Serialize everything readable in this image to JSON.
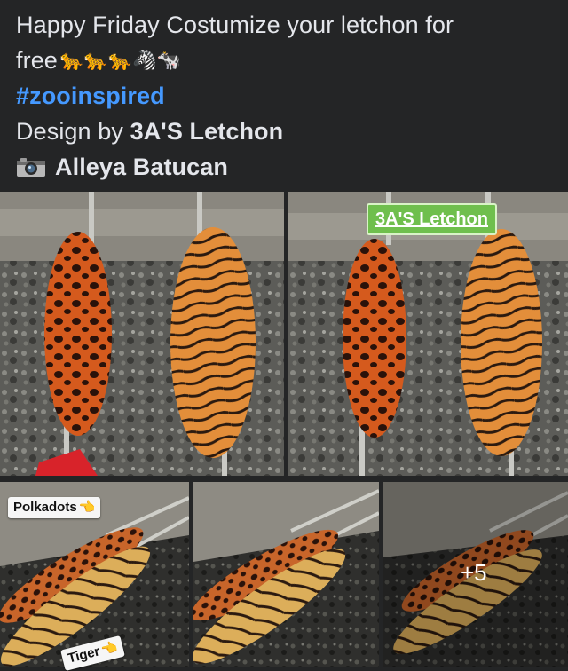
{
  "post": {
    "line1": "Happy Friday Costumize your letchon for",
    "line2_text": "free",
    "line2_emojis": "🐆🐆🐆🦓🐄",
    "hashtag": "#zooinspired",
    "design_prefix": "Design by ",
    "designer": "3A'S Letchon",
    "photographer": "Alleya Batucan"
  },
  "photos": {
    "watermark": "3A'S Letchon",
    "polkadots_label": "Polkadots",
    "tiger_label": "Tiger",
    "hand_emoji": "👈",
    "hand_emoji_2": "👈",
    "more_count": "+5"
  },
  "colors": {
    "background": "#242526",
    "text": "#e4e6eb",
    "hashtag": "#4599ff",
    "watermark_green": "#6fbf4d"
  },
  "icons": {
    "camera": "camera-icon",
    "pointing_hand": "pointing-hand-icon"
  }
}
